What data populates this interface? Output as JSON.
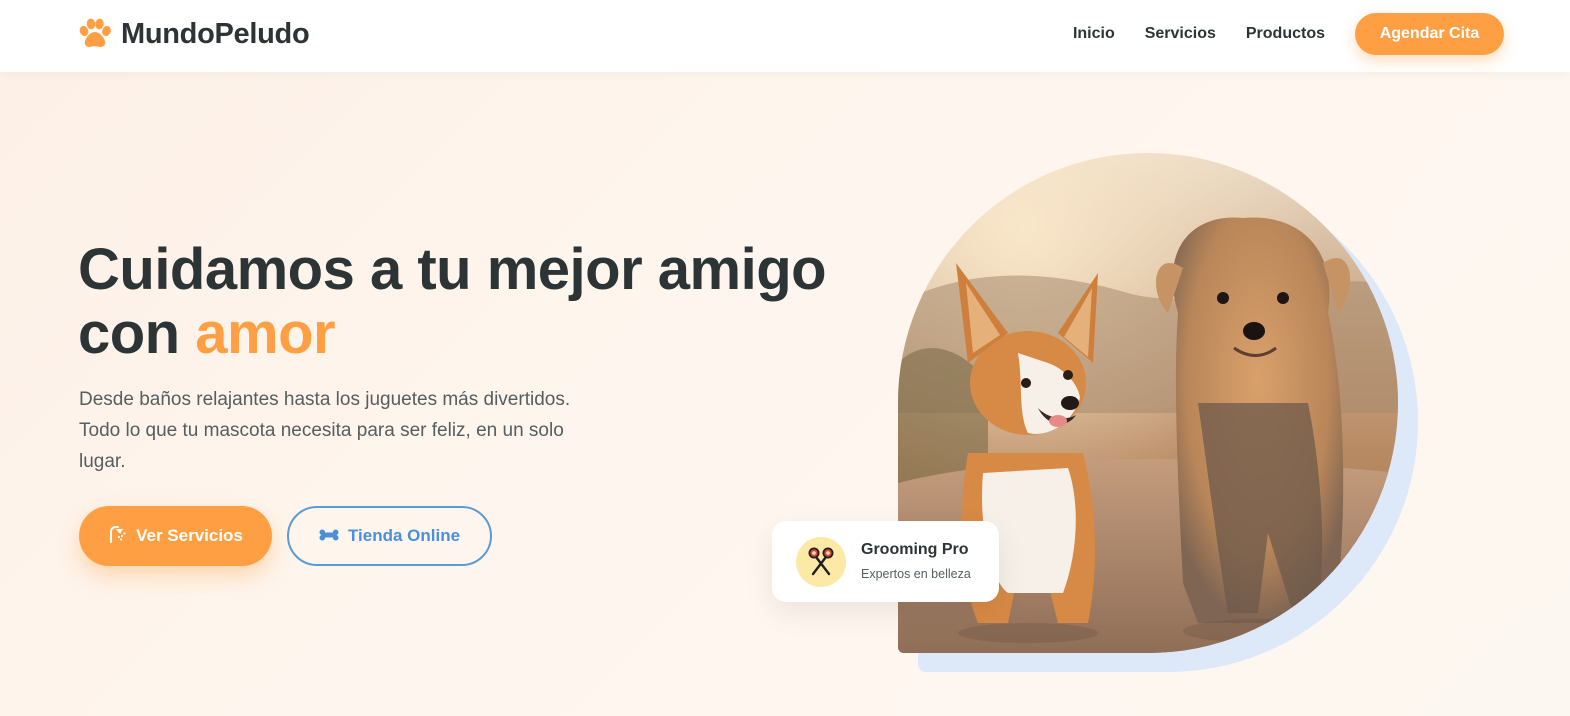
{
  "brand": {
    "name": "MundoPeludo",
    "icon": "paw-icon",
    "accent_color": "#ff9f43",
    "secondary_color": "#4a90d9"
  },
  "nav": {
    "links": [
      "Inicio",
      "Servicios",
      "Productos"
    ],
    "cta_label": "Agendar Cita"
  },
  "hero": {
    "title_main": "Cuidamos a tu mejor amigo con",
    "title_accent": "amor",
    "subtitle": "Desde baños relajantes hasta los juguetes más divertidos. Todo lo que tu mascota necesita para ser feliz, en un solo lugar.",
    "primary_button": {
      "label": "Ver Servicios",
      "icon": "shower-icon"
    },
    "secondary_button": {
      "label": "Tienda Online",
      "icon": "bone-icon"
    },
    "image_alt": "dogs-photo"
  },
  "badge_card": {
    "icon": "scissors-icon",
    "title": "Grooming Pro",
    "subtitle": "Expertos en belleza"
  }
}
